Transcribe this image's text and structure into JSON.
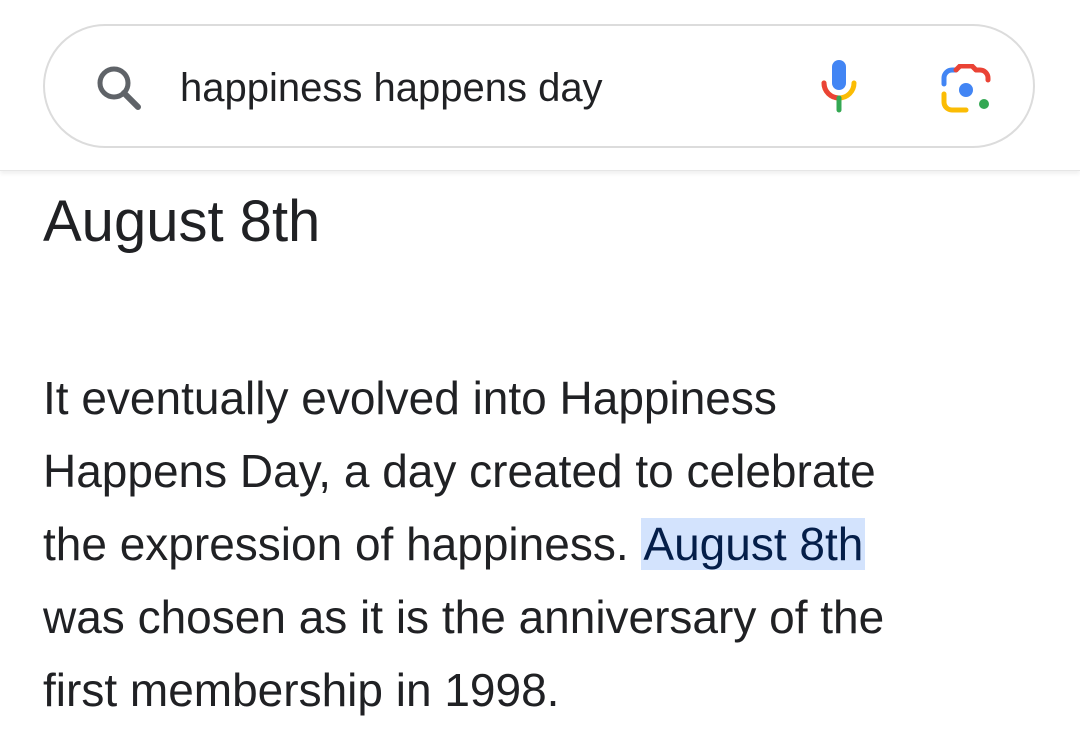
{
  "search": {
    "query": "happiness happens day",
    "icons": {
      "search": "search-icon",
      "voice": "microphone-icon",
      "lens": "google-lens-icon"
    }
  },
  "answer": {
    "title": "August 8th"
  },
  "snippet": {
    "line1": "It eventually evolved into Happiness",
    "line2": "Happens Day, a day created to celebrate",
    "line3_before": "the expression of happiness. ",
    "line3_highlight": "August 8th",
    "line4": "was chosen as it is the anniversary of the",
    "line5": "first membership in 1998."
  },
  "colors": {
    "highlight_bg": "#d3e3fd",
    "highlight_text": "#041e49",
    "google_blue": "#4285f4",
    "google_red": "#ea4335",
    "google_yellow": "#fbbc04",
    "google_green": "#34a853"
  }
}
